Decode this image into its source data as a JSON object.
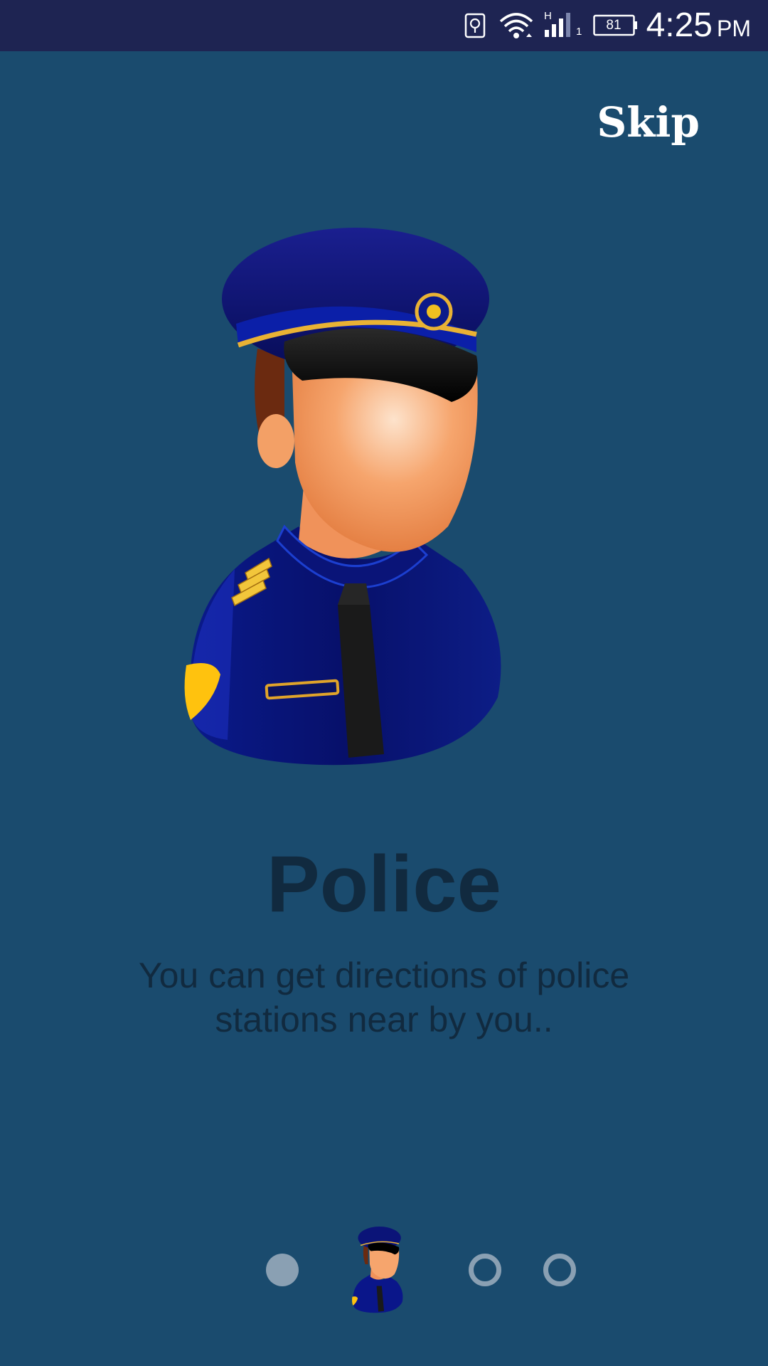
{
  "status_bar": {
    "battery_level": "81",
    "network_type": "H",
    "sim_slot": "1",
    "time": "4:25",
    "ampm": "PM",
    "icons": [
      "sim-card-icon",
      "wifi-icon",
      "signal-icon",
      "battery-icon"
    ]
  },
  "onboarding": {
    "skip_label": "Skip",
    "title": "Police",
    "description": "You can get directions of police stations near by you..",
    "hero_icon": "police-officer-icon",
    "pager": {
      "total": 4,
      "current": 2
    }
  },
  "colors": {
    "background": "#1a4b6e",
    "status_bar": "#1e2452",
    "title_text": "#112a3f",
    "indicator": "#8aa0b3",
    "skip_text": "#ffffff"
  }
}
